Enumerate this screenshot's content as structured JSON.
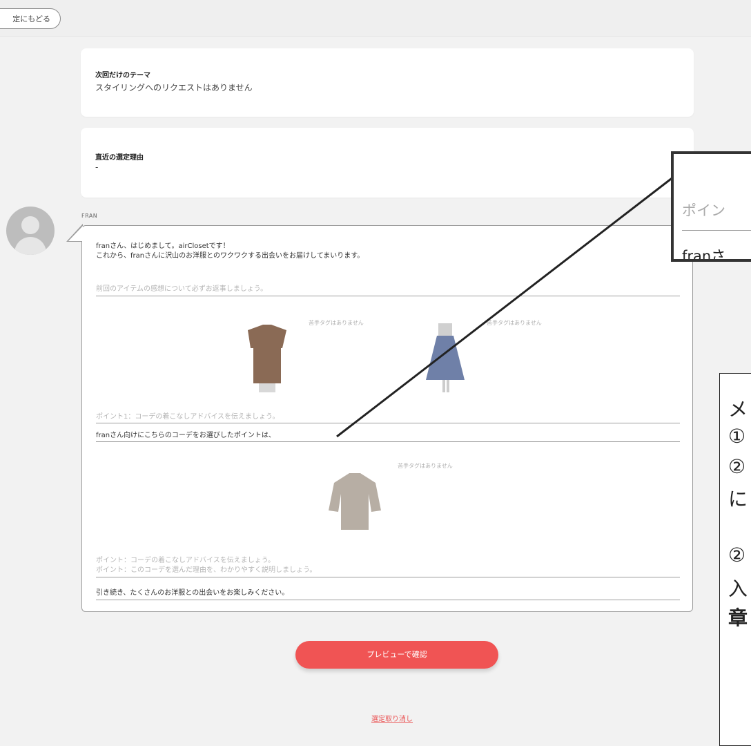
{
  "nav": {
    "back_label": "定にもどる"
  },
  "theme_card": {
    "title": "次回だけのテーマ",
    "body": "スタイリングへのリクエストはありません"
  },
  "reason_card": {
    "title": "直近の選定理由",
    "body": "-"
  },
  "stylist": {
    "name": "FRAN"
  },
  "message": {
    "greeting_line1": "franさん、はじめまして。airClosetです！",
    "greeting_line2": "これから、franさんに沢山のお洋服とのワクワクする出会いをお届けしてまいります。",
    "prev_hint": "前回のアイテムの感想について必ずお返事しましょう。",
    "items_row1": [
      {
        "icon": "blouse-brown-icon",
        "tag": "苦手タグはありません"
      },
      {
        "icon": "skirt-blue-icon",
        "tag": "苦手タグはありません"
      }
    ],
    "point1_hint": "ポイント1：コーデの着こなしアドバイスを伝えましょう。",
    "point1_text": "franさん向けにこちらのコーデをお選びしたポイントは、",
    "items_row2": [
      {
        "icon": "blouse-beige-icon",
        "tag": "苦手タグはありません"
      }
    ],
    "point_hint_a": "ポイント：コーデの着こなしアドバイスを伝えましょう。",
    "point_hint_b": "ポイント：このコーデを選んだ理由を、わかりやすく説明しましょう。",
    "closing": "引き続き、たくさんのお洋服との出会いをお楽しみください。"
  },
  "actions": {
    "preview_label": "プレビューで確認",
    "cancel_label": "選定取り消し"
  },
  "callout_zoom": {
    "line1": "ポイン",
    "line2": "franさ"
  },
  "callout_note": {
    "lines": [
      "メ",
      "①",
      "②",
      "に",
      "②",
      "入",
      "章"
    ]
  },
  "colors": {
    "accent": "#f05454",
    "link": "#ea5455"
  }
}
